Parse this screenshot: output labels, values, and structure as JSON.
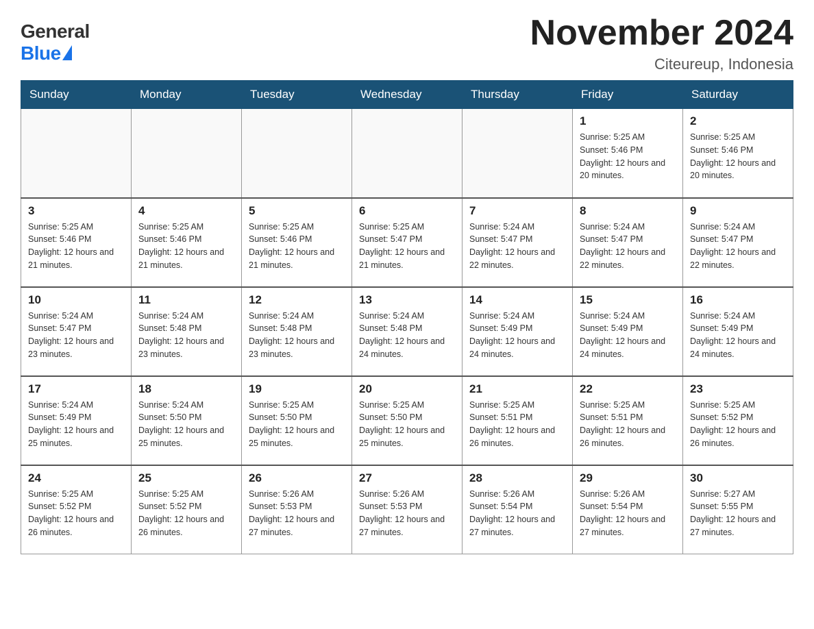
{
  "logo": {
    "general": "General",
    "blue": "Blue"
  },
  "title": "November 2024",
  "location": "Citeureup, Indonesia",
  "weekdays": [
    "Sunday",
    "Monday",
    "Tuesday",
    "Wednesday",
    "Thursday",
    "Friday",
    "Saturday"
  ],
  "weeks": [
    [
      {
        "day": "",
        "sunrise": "",
        "sunset": "",
        "daylight": ""
      },
      {
        "day": "",
        "sunrise": "",
        "sunset": "",
        "daylight": ""
      },
      {
        "day": "",
        "sunrise": "",
        "sunset": "",
        "daylight": ""
      },
      {
        "day": "",
        "sunrise": "",
        "sunset": "",
        "daylight": ""
      },
      {
        "day": "",
        "sunrise": "",
        "sunset": "",
        "daylight": ""
      },
      {
        "day": "1",
        "sunrise": "Sunrise: 5:25 AM",
        "sunset": "Sunset: 5:46 PM",
        "daylight": "Daylight: 12 hours and 20 minutes."
      },
      {
        "day": "2",
        "sunrise": "Sunrise: 5:25 AM",
        "sunset": "Sunset: 5:46 PM",
        "daylight": "Daylight: 12 hours and 20 minutes."
      }
    ],
    [
      {
        "day": "3",
        "sunrise": "Sunrise: 5:25 AM",
        "sunset": "Sunset: 5:46 PM",
        "daylight": "Daylight: 12 hours and 21 minutes."
      },
      {
        "day": "4",
        "sunrise": "Sunrise: 5:25 AM",
        "sunset": "Sunset: 5:46 PM",
        "daylight": "Daylight: 12 hours and 21 minutes."
      },
      {
        "day": "5",
        "sunrise": "Sunrise: 5:25 AM",
        "sunset": "Sunset: 5:46 PM",
        "daylight": "Daylight: 12 hours and 21 minutes."
      },
      {
        "day": "6",
        "sunrise": "Sunrise: 5:25 AM",
        "sunset": "Sunset: 5:47 PM",
        "daylight": "Daylight: 12 hours and 21 minutes."
      },
      {
        "day": "7",
        "sunrise": "Sunrise: 5:24 AM",
        "sunset": "Sunset: 5:47 PM",
        "daylight": "Daylight: 12 hours and 22 minutes."
      },
      {
        "day": "8",
        "sunrise": "Sunrise: 5:24 AM",
        "sunset": "Sunset: 5:47 PM",
        "daylight": "Daylight: 12 hours and 22 minutes."
      },
      {
        "day": "9",
        "sunrise": "Sunrise: 5:24 AM",
        "sunset": "Sunset: 5:47 PM",
        "daylight": "Daylight: 12 hours and 22 minutes."
      }
    ],
    [
      {
        "day": "10",
        "sunrise": "Sunrise: 5:24 AM",
        "sunset": "Sunset: 5:47 PM",
        "daylight": "Daylight: 12 hours and 23 minutes."
      },
      {
        "day": "11",
        "sunrise": "Sunrise: 5:24 AM",
        "sunset": "Sunset: 5:48 PM",
        "daylight": "Daylight: 12 hours and 23 minutes."
      },
      {
        "day": "12",
        "sunrise": "Sunrise: 5:24 AM",
        "sunset": "Sunset: 5:48 PM",
        "daylight": "Daylight: 12 hours and 23 minutes."
      },
      {
        "day": "13",
        "sunrise": "Sunrise: 5:24 AM",
        "sunset": "Sunset: 5:48 PM",
        "daylight": "Daylight: 12 hours and 24 minutes."
      },
      {
        "day": "14",
        "sunrise": "Sunrise: 5:24 AM",
        "sunset": "Sunset: 5:49 PM",
        "daylight": "Daylight: 12 hours and 24 minutes."
      },
      {
        "day": "15",
        "sunrise": "Sunrise: 5:24 AM",
        "sunset": "Sunset: 5:49 PM",
        "daylight": "Daylight: 12 hours and 24 minutes."
      },
      {
        "day": "16",
        "sunrise": "Sunrise: 5:24 AM",
        "sunset": "Sunset: 5:49 PM",
        "daylight": "Daylight: 12 hours and 24 minutes."
      }
    ],
    [
      {
        "day": "17",
        "sunrise": "Sunrise: 5:24 AM",
        "sunset": "Sunset: 5:49 PM",
        "daylight": "Daylight: 12 hours and 25 minutes."
      },
      {
        "day": "18",
        "sunrise": "Sunrise: 5:24 AM",
        "sunset": "Sunset: 5:50 PM",
        "daylight": "Daylight: 12 hours and 25 minutes."
      },
      {
        "day": "19",
        "sunrise": "Sunrise: 5:25 AM",
        "sunset": "Sunset: 5:50 PM",
        "daylight": "Daylight: 12 hours and 25 minutes."
      },
      {
        "day": "20",
        "sunrise": "Sunrise: 5:25 AM",
        "sunset": "Sunset: 5:50 PM",
        "daylight": "Daylight: 12 hours and 25 minutes."
      },
      {
        "day": "21",
        "sunrise": "Sunrise: 5:25 AM",
        "sunset": "Sunset: 5:51 PM",
        "daylight": "Daylight: 12 hours and 26 minutes."
      },
      {
        "day": "22",
        "sunrise": "Sunrise: 5:25 AM",
        "sunset": "Sunset: 5:51 PM",
        "daylight": "Daylight: 12 hours and 26 minutes."
      },
      {
        "day": "23",
        "sunrise": "Sunrise: 5:25 AM",
        "sunset": "Sunset: 5:52 PM",
        "daylight": "Daylight: 12 hours and 26 minutes."
      }
    ],
    [
      {
        "day": "24",
        "sunrise": "Sunrise: 5:25 AM",
        "sunset": "Sunset: 5:52 PM",
        "daylight": "Daylight: 12 hours and 26 minutes."
      },
      {
        "day": "25",
        "sunrise": "Sunrise: 5:25 AM",
        "sunset": "Sunset: 5:52 PM",
        "daylight": "Daylight: 12 hours and 26 minutes."
      },
      {
        "day": "26",
        "sunrise": "Sunrise: 5:26 AM",
        "sunset": "Sunset: 5:53 PM",
        "daylight": "Daylight: 12 hours and 27 minutes."
      },
      {
        "day": "27",
        "sunrise": "Sunrise: 5:26 AM",
        "sunset": "Sunset: 5:53 PM",
        "daylight": "Daylight: 12 hours and 27 minutes."
      },
      {
        "day": "28",
        "sunrise": "Sunrise: 5:26 AM",
        "sunset": "Sunset: 5:54 PM",
        "daylight": "Daylight: 12 hours and 27 minutes."
      },
      {
        "day": "29",
        "sunrise": "Sunrise: 5:26 AM",
        "sunset": "Sunset: 5:54 PM",
        "daylight": "Daylight: 12 hours and 27 minutes."
      },
      {
        "day": "30",
        "sunrise": "Sunrise: 5:27 AM",
        "sunset": "Sunset: 5:55 PM",
        "daylight": "Daylight: 12 hours and 27 minutes."
      }
    ]
  ]
}
